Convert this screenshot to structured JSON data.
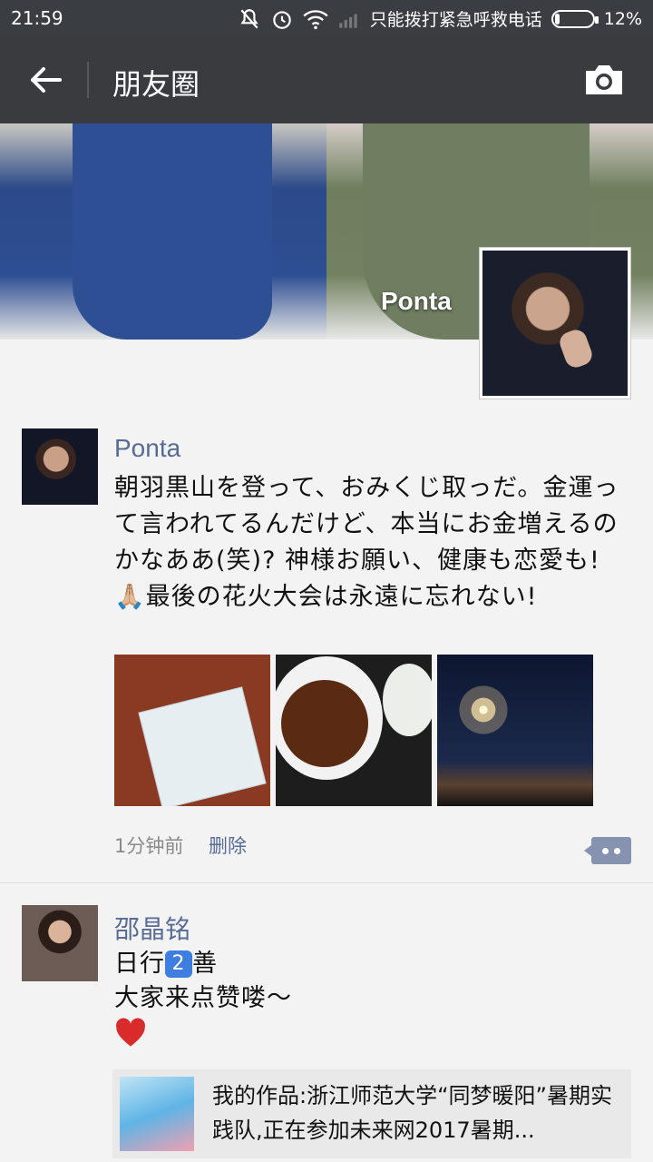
{
  "status_bar": {
    "time": "21:59",
    "carrier": "只能拨打紧急呼救电话",
    "battery_percent": "12%",
    "battery_level": 0.12
  },
  "header": {
    "title": "朋友圈",
    "back_icon": "arrow-left-icon",
    "camera_icon": "camera-icon"
  },
  "cover": {
    "username": "Ponta"
  },
  "posts": [
    {
      "name": "Ponta",
      "text": "朝羽黒山を登って、おみくじ取っだ。金運って言われてるんだけど、本当にお金増えるのかなああ(笑)? 神様お願い、健康も恋愛も! 🙏🏼最後の花火大会は永遠に忘れない!",
      "time": "1分钟前",
      "delete_label": "删除",
      "photos": [
        "omikuji",
        "curry",
        "fireworks"
      ]
    },
    {
      "name": "邵晶铭",
      "line1_prefix": "日行",
      "line1_num": "2",
      "line1_suffix": "善",
      "line2": "大家来点赞喽～",
      "link_title": "我的作品:浙江师范大学“同梦暖阳”暑期实践队,正在参加未来网2017暑期..."
    }
  ],
  "colors": {
    "statusbar": "#3a3d42",
    "topbar": "#393b3f",
    "link_blue": "#576b95"
  }
}
